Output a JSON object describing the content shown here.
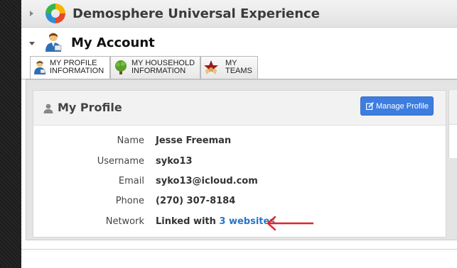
{
  "app": {
    "title": "Demosphere Universal Experience",
    "logo_icon": "demosphere-logo-icon"
  },
  "account": {
    "title": "My Account",
    "icon": "user-avatar-icon"
  },
  "tabs": [
    {
      "line1": "MY PROFILE",
      "line2": "INFORMATION",
      "icon": "profile-user-icon",
      "active": true
    },
    {
      "line1": "MY HOUSEHOLD",
      "line2": "INFORMATION",
      "icon": "tree-icon",
      "active": false
    },
    {
      "line1": "MY",
      "line2": "TEAMS",
      "icon": "star-team-icon",
      "active": false
    }
  ],
  "profile": {
    "title": "My Profile",
    "manage_label": "Manage Profile",
    "fields": {
      "name_label": "Name",
      "name_value": "Jesse Freeman",
      "username_label": "Username",
      "username_value": "syko13",
      "email_label": "Email",
      "email_value": "syko13@icloud.com",
      "phone_label": "Phone",
      "phone_value": "(270) 307-8184",
      "network_label": "Network",
      "network_prefix": "Linked with",
      "network_link": "3 websites"
    }
  },
  "colors": {
    "accent": "#3d7de0",
    "link": "#2a76c6",
    "annotation_arrow": "#e0242c"
  }
}
